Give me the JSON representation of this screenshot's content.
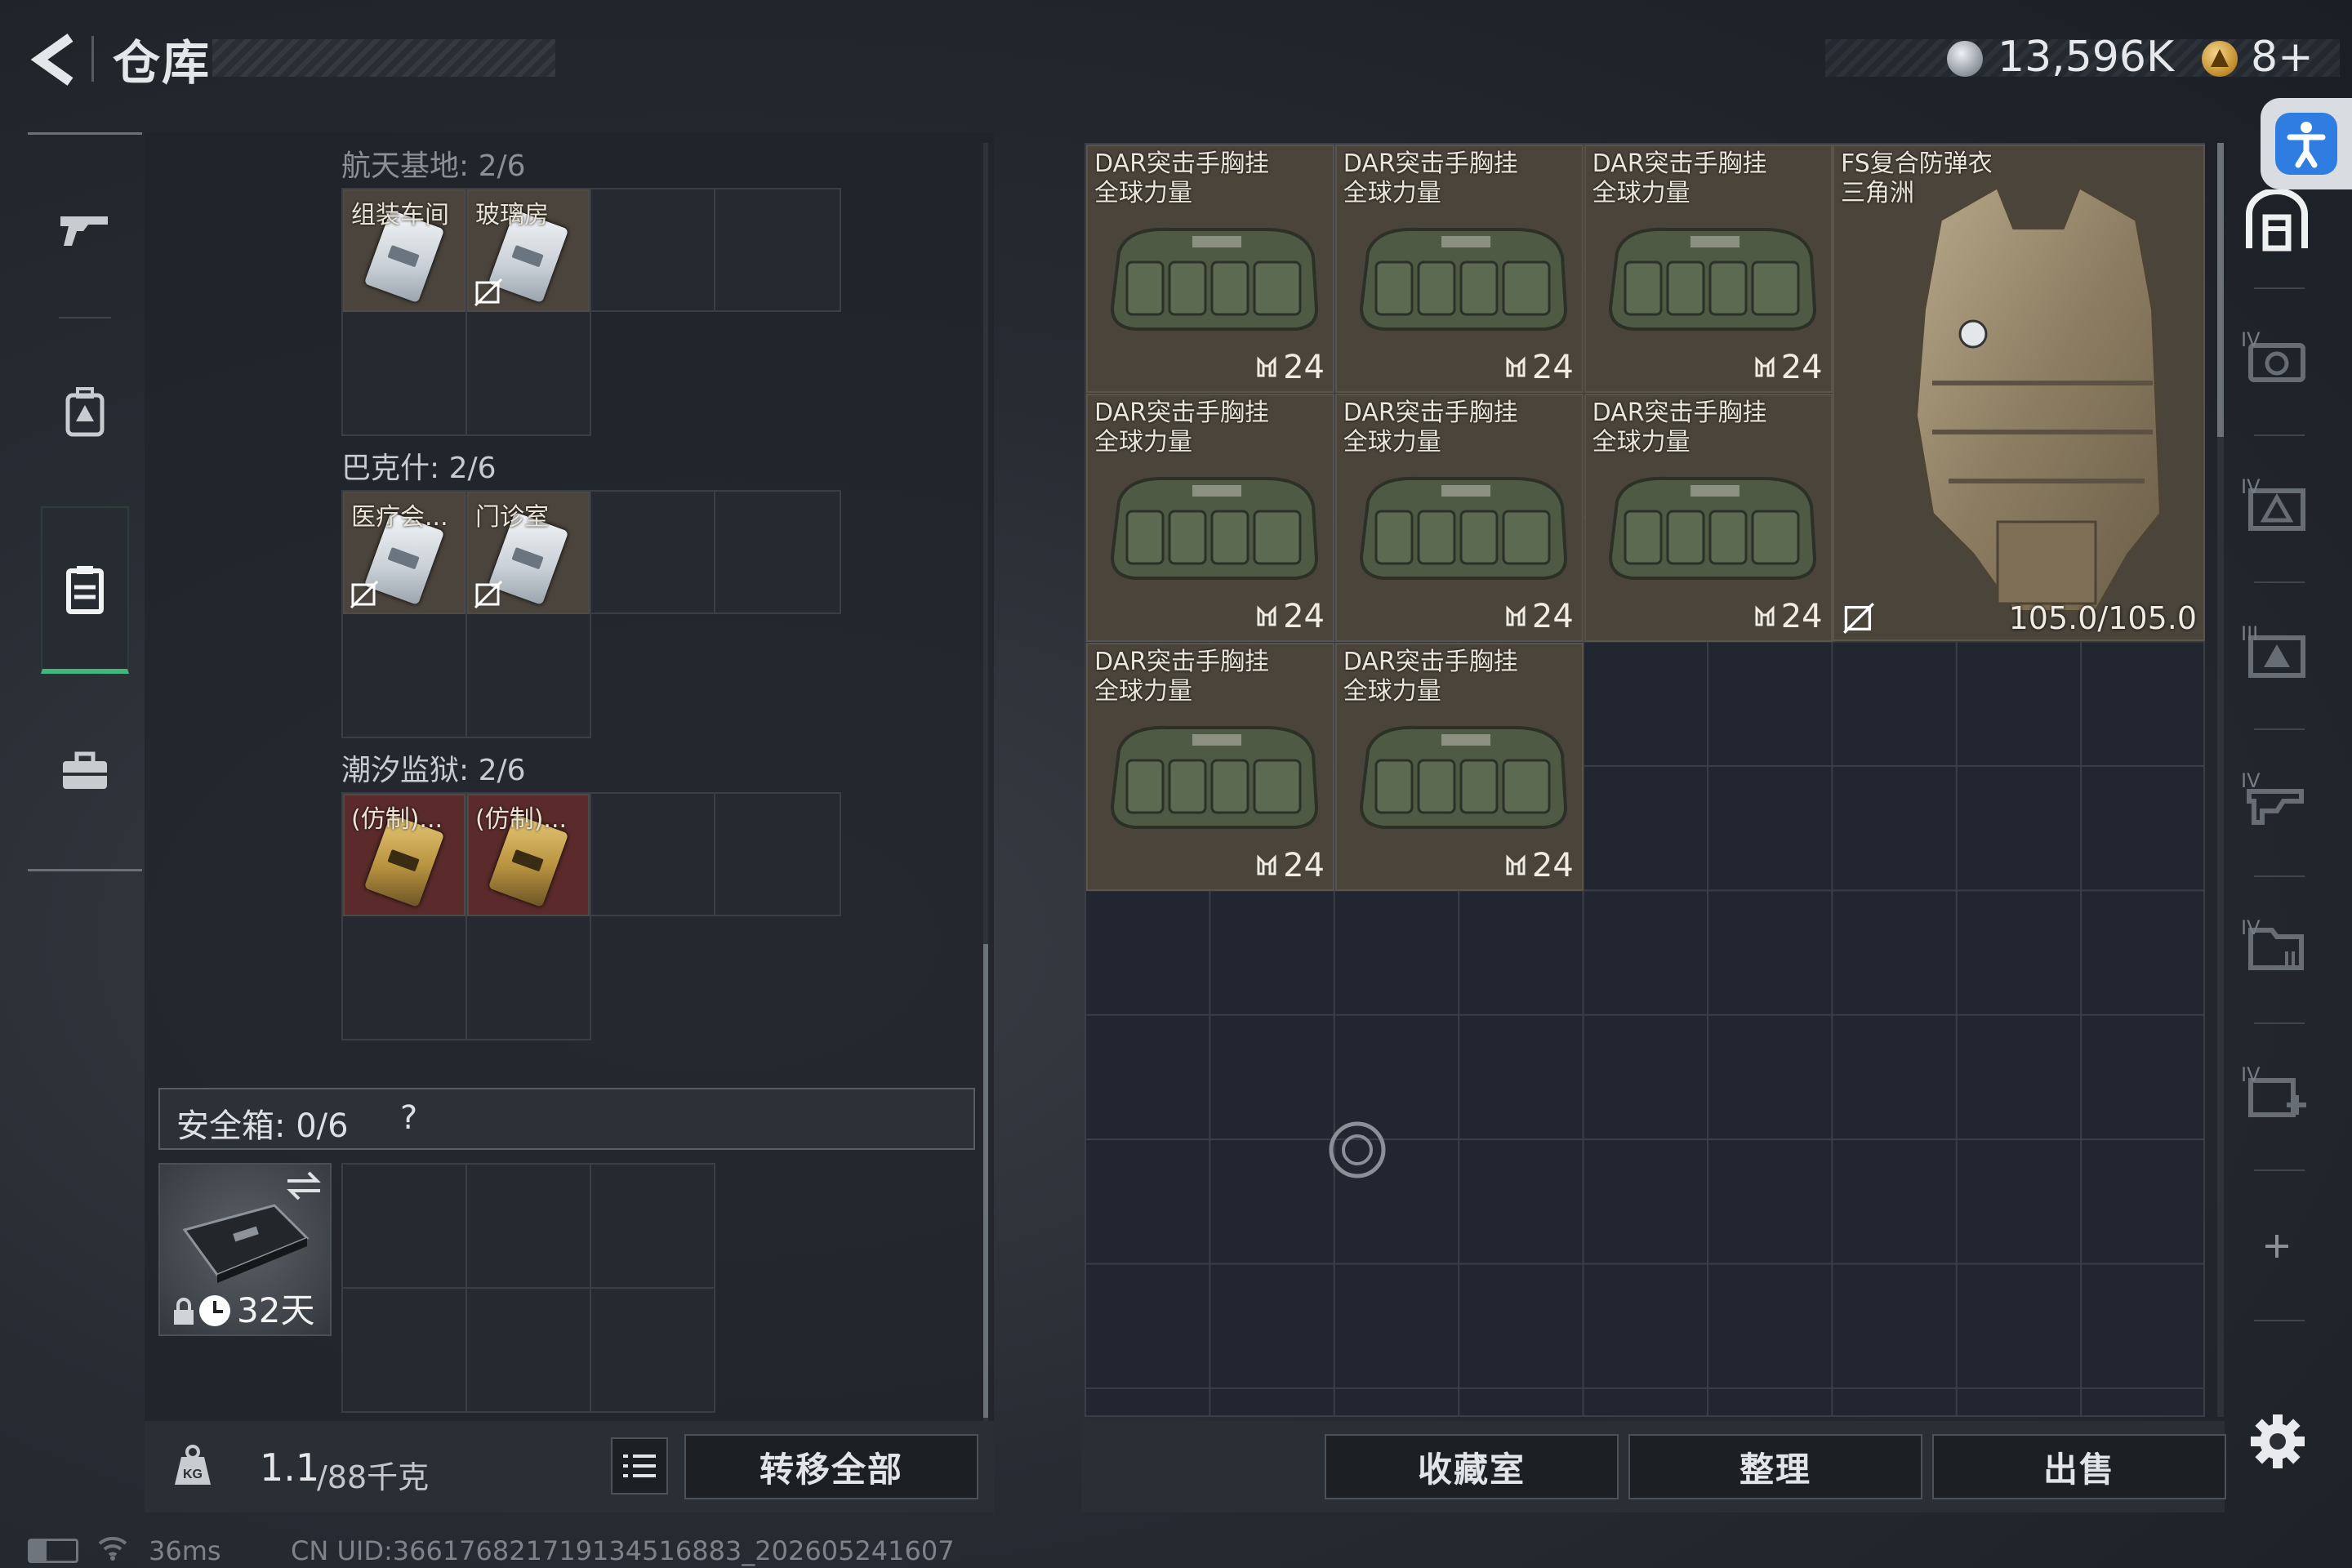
{
  "header": {
    "title": "仓库",
    "currency_amount": "13,596K",
    "ticket_count": "8+"
  },
  "nav": [
    "weapon-icon",
    "backpack-icon",
    "container-icon",
    "toolbox-icon"
  ],
  "sections": [
    {
      "label": "航天基地: 2/6",
      "items": [
        {
          "label": "组装车间",
          "type": "key"
        },
        {
          "label": "玻璃房",
          "type": "key"
        }
      ]
    },
    {
      "label": "巴克什: 2/6",
      "items": [
        {
          "label": "医疗会...",
          "type": "key"
        },
        {
          "label": "门诊室",
          "type": "key"
        }
      ]
    },
    {
      "label": "潮汐监狱: 2/6",
      "items": [
        {
          "label": "(仿制)...",
          "type": "gold"
        },
        {
          "label": "(仿制)...",
          "type": "gold"
        }
      ]
    }
  ],
  "safe": {
    "label": "安全箱: 0/6",
    "help": "?",
    "days": "32天"
  },
  "weight": {
    "value": "1.1",
    "capacity": "/88千克"
  },
  "buttons": {
    "transfer_all": "转移全部",
    "collection": "收藏室",
    "organize": "整理",
    "sell": "出售"
  },
  "stash_items": [
    {
      "line1": "DAR突击手胸挂",
      "line2": "全球力量",
      "count": "24"
    },
    {
      "line1": "DAR突击手胸挂",
      "line2": "全球力量",
      "count": "24"
    },
    {
      "line1": "DAR突击手胸挂",
      "line2": "全球力量",
      "count": "24"
    },
    {
      "line1": "DAR突击手胸挂",
      "line2": "全球力量",
      "count": "24"
    },
    {
      "line1": "DAR突击手胸挂",
      "line2": "全球力量",
      "count": "24"
    },
    {
      "line1": "DAR突击手胸挂",
      "line2": "全球力量",
      "count": "24"
    },
    {
      "line1": "DAR突击手胸挂",
      "line2": "全球力量",
      "count": "24"
    },
    {
      "line1": "DAR突击手胸挂",
      "line2": "全球力量",
      "count": "24"
    }
  ],
  "armor": {
    "line1": "FS复合防弹衣",
    "line2": "三角洲",
    "durability": "105.0/105.0"
  },
  "side_tabs": [
    "IV",
    "IV",
    "III",
    "IV",
    "IV",
    "IV"
  ],
  "status": {
    "ping": "36ms",
    "uid": "CN UID:366176821719134516883_202605241607"
  },
  "colors": {
    "accent_green": "#3fb87c",
    "item_bg": "#4a443b",
    "gold_bg": "#5a2b2a",
    "accessibility_blue": "#2f7de0"
  }
}
